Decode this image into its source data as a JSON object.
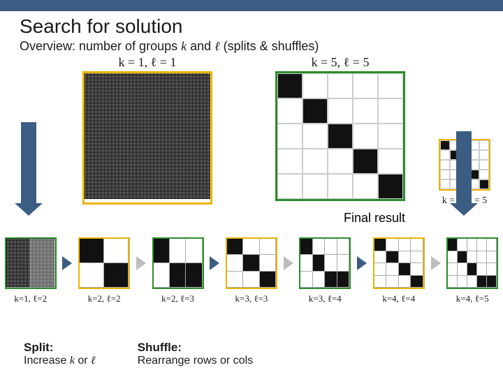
{
  "title": "Search for solution",
  "subtitle_pre": "Overview: number of groups ",
  "subtitle_k": "k",
  "subtitle_mid": " and ",
  "subtitle_l": "ℓ",
  "subtitle_post": " (splits & shuffles)",
  "cap_left": "k = 1,  ℓ = 1",
  "cap_right": "k = 5,  ℓ = 5",
  "cap_small": "k = 5,  ℓ = 5",
  "final_label": "Final result",
  "strip": [
    {
      "label": "k=1, ℓ=2",
      "box": "green",
      "arrow": "blue"
    },
    {
      "label": "k=2, ℓ=2",
      "box": "yellow",
      "arrow": "grey"
    },
    {
      "label": "k=2, ℓ=3",
      "box": "green",
      "arrow": "blue"
    },
    {
      "label": "k=3, ℓ=3",
      "box": "yellow",
      "arrow": "grey"
    },
    {
      "label": "k=3, ℓ=4",
      "box": "green",
      "arrow": "blue"
    },
    {
      "label": "k=4, ℓ=4",
      "box": "yellow",
      "arrow": "grey"
    },
    {
      "label": "k=4, ℓ=5",
      "box": "green",
      "arrow": null
    }
  ],
  "legend": {
    "split_h": "Split:",
    "split_t_pre": "Increase ",
    "split_t_k": "k",
    "split_t_mid": " or ",
    "split_t_l": "ℓ",
    "shuffle_h": "Shuffle:",
    "shuffle_t": "Rearrange rows or cols"
  }
}
